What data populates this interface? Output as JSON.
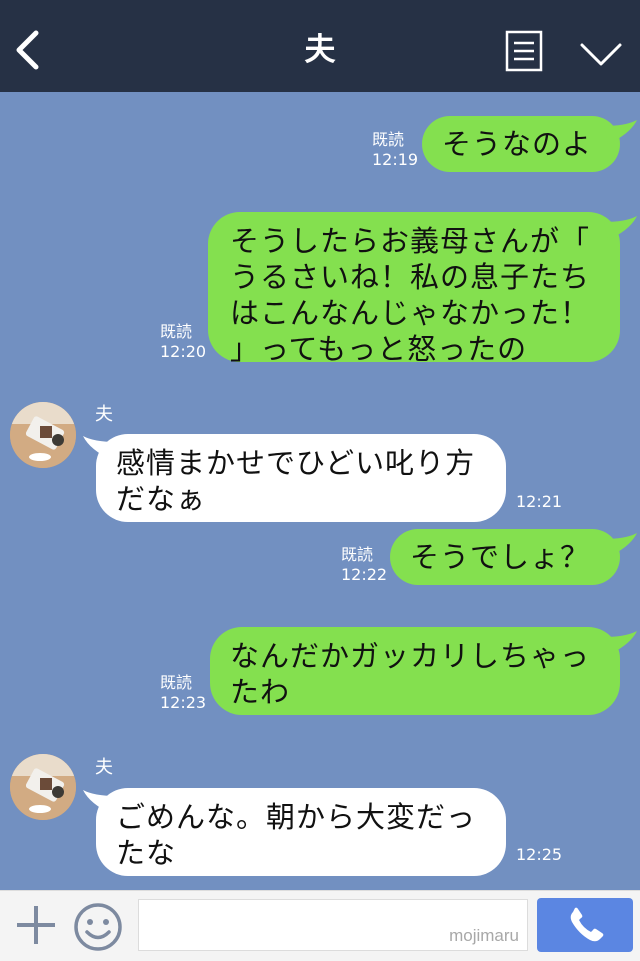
{
  "header": {
    "title": "夫"
  },
  "messages": [
    {
      "side": "me",
      "read": "既読",
      "time": "12:19",
      "lines": [
        "そうなのよ"
      ]
    },
    {
      "side": "me",
      "read": "既読",
      "time": "12:20",
      "lines": [
        "そうしたらお義母さんが「",
        "うるさいね！私の息子たち",
        "はこんなんじゃなかった！",
        "」ってもっと怒ったの"
      ]
    },
    {
      "side": "them",
      "name": "夫",
      "time": "12:21",
      "lines": [
        "感情まかせでひどい叱り方",
        "だなぁ"
      ]
    },
    {
      "side": "me",
      "read": "既読",
      "time": "12:22",
      "lines": [
        "そうでしょ？"
      ]
    },
    {
      "side": "me",
      "read": "既読",
      "time": "12:23",
      "lines": [
        "なんだかガッカリしちゃっ",
        "たわ"
      ]
    },
    {
      "side": "them",
      "name": "夫",
      "time": "12:25",
      "lines": [
        "ごめんな。朝から大変だっ",
        "たな"
      ]
    }
  ],
  "footer": {
    "input_value": "",
    "watermark": "mojimaru"
  },
  "colors": {
    "header_bg": "#263145",
    "chat_bg": "#7290c1",
    "my_bubble": "#84e04f",
    "their_bubble": "#ffffff",
    "call_button": "#5b86e2"
  },
  "icons": [
    "back-arrow-icon",
    "notes-icon",
    "chevron-down-icon",
    "plus-icon",
    "smiley-icon",
    "phone-icon",
    "avatar"
  ]
}
